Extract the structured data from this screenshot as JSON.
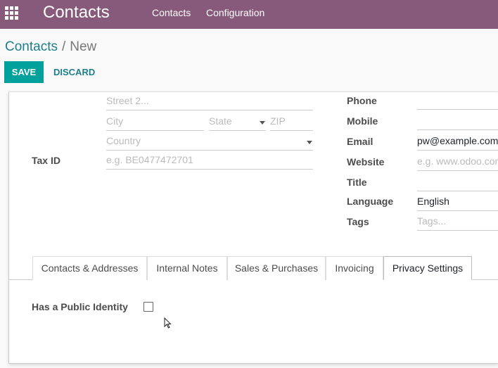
{
  "navbar": {
    "apps_icon": "grid-icon",
    "brand": "Contacts",
    "menu": [
      "Contacts",
      "Configuration"
    ],
    "color": "#875a7b"
  },
  "breadcrumb": {
    "parent": "Contacts",
    "separator": "/",
    "current": "New"
  },
  "buttons": {
    "save": "SAVE",
    "discard": "DISCARD",
    "accent": "#00a09d"
  },
  "address": {
    "street2_placeholder": "Street 2...",
    "city_placeholder": "City",
    "state_placeholder": "State",
    "zip_placeholder": "ZIP",
    "country_placeholder": "Country"
  },
  "tax": {
    "label": "Tax ID",
    "placeholder": "e.g. BE0477472701"
  },
  "contact_fields": {
    "phone_label": "Phone",
    "mobile_label": "Mobile",
    "email_label": "Email",
    "email_value": "pw@example.com",
    "website_label": "Website",
    "website_placeholder": "e.g. www.odoo.com",
    "title_label": "Title",
    "language_label": "Language",
    "language_value": "English",
    "tags_label": "Tags",
    "tags_placeholder": "Tags..."
  },
  "tabs": [
    "Contacts & Addresses",
    "Internal Notes",
    "Sales & Purchases",
    "Invoicing",
    "Privacy Settings"
  ],
  "active_tab": "Privacy Settings",
  "privacy": {
    "public_identity_label": "Has a Public Identity",
    "public_identity_checked": false
  }
}
